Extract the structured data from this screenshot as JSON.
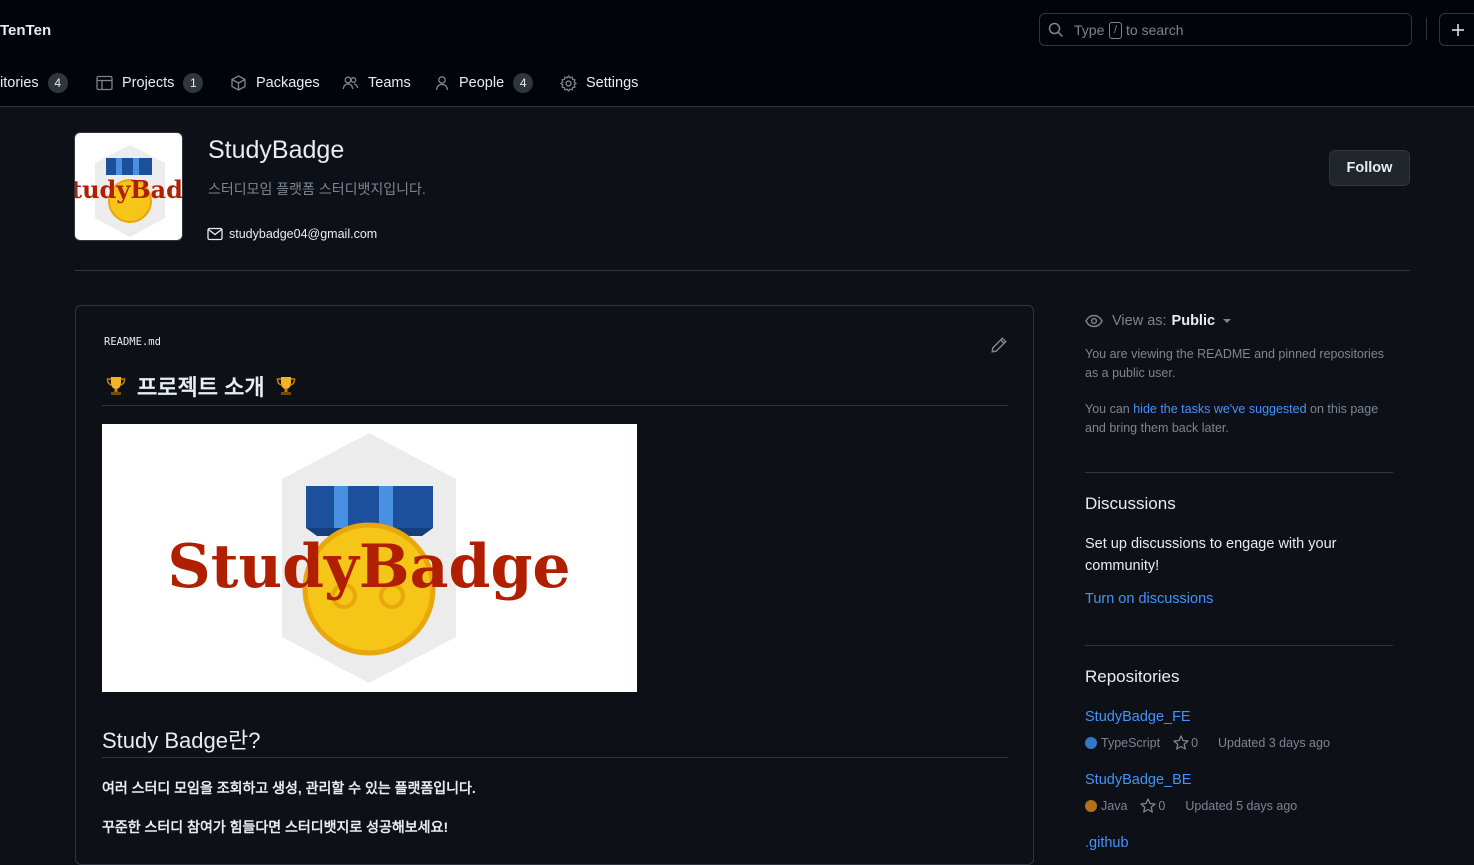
{
  "header": {
    "org_name": "TenTen",
    "search_before": "Type",
    "search_key": "/",
    "search_after": "to search"
  },
  "nav": {
    "repositories": {
      "label": "itories",
      "count": "4"
    },
    "projects": {
      "label": "Projects",
      "count": "1"
    },
    "packages": {
      "label": "Packages"
    },
    "teams": {
      "label": "Teams"
    },
    "people": {
      "label": "People",
      "count": "4"
    },
    "settings": {
      "label": "Settings"
    }
  },
  "profile": {
    "name": "StudyBadge",
    "description": "스터디모임 플랫폼 스터디뱃지입니다.",
    "email": "studybadge04@gmail.com",
    "follow_label": "Follow",
    "avatar_text": "tudyBadg"
  },
  "readme": {
    "filename": "README.md",
    "heading": "프로젝트 소개",
    "banner_text": "StudyBadge",
    "subheading": "Study Badge란?",
    "para1": "여러 스터디 모임을 조회하고 생성, 관리할 수 있는 플랫폼입니다.",
    "para2": "꾸준한 스터디 참여가 힘들다면 스터디뱃지로 성공해보세요!"
  },
  "sidebar": {
    "view_as_label": "View as:",
    "view_as_value": "Public",
    "info1": "You are viewing the README and pinned repositories as a public user.",
    "info2_before": "You can",
    "info2_link": "hide the tasks we've suggested",
    "info2_after": "on this page and bring them back later.",
    "discussions_title": "Discussions",
    "discussions_text": "Set up discussions to engage with your community!",
    "discussions_link": "Turn on discussions",
    "repositories_title": "Repositories",
    "repos": [
      {
        "name": "StudyBadge_FE",
        "language": "TypeScript",
        "lang_color": "#3178c6",
        "stars": "0",
        "updated": "Updated 3 days ago"
      },
      {
        "name": "StudyBadge_BE",
        "language": "Java",
        "lang_color": "#b07219",
        "stars": "0",
        "updated": "Updated 5 days ago"
      },
      {
        "name": ".github"
      }
    ]
  }
}
